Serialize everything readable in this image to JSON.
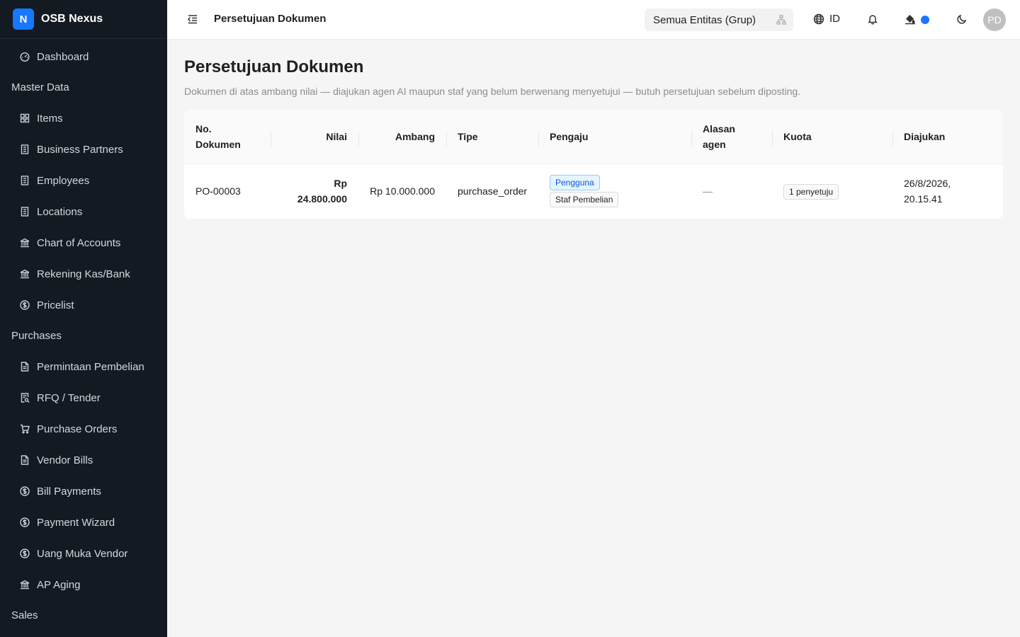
{
  "brand": {
    "logo_letter": "N",
    "name": "OSB Nexus"
  },
  "sidebar": {
    "items": [
      {
        "type": "item",
        "label": "Dashboard",
        "icon": "dashboard-icon"
      },
      {
        "type": "group",
        "label": "Master Data"
      },
      {
        "type": "item",
        "label": "Items",
        "icon": "grid-icon"
      },
      {
        "type": "item",
        "label": "Business Partners",
        "icon": "building-icon"
      },
      {
        "type": "item",
        "label": "Employees",
        "icon": "building-icon"
      },
      {
        "type": "item",
        "label": "Locations",
        "icon": "building-icon"
      },
      {
        "type": "item",
        "label": "Chart of Accounts",
        "icon": "bank-icon"
      },
      {
        "type": "item",
        "label": "Rekening Kas/Bank",
        "icon": "bank-icon"
      },
      {
        "type": "item",
        "label": "Pricelist",
        "icon": "dollar-icon"
      },
      {
        "type": "group",
        "label": "Purchases"
      },
      {
        "type": "item",
        "label": "Permintaan Pembelian",
        "icon": "document-icon"
      },
      {
        "type": "item",
        "label": "RFQ / Tender",
        "icon": "document-search-icon"
      },
      {
        "type": "item",
        "label": "Purchase Orders",
        "icon": "cart-icon"
      },
      {
        "type": "item",
        "label": "Vendor Bills",
        "icon": "document-icon"
      },
      {
        "type": "item",
        "label": "Bill Payments",
        "icon": "dollar-icon"
      },
      {
        "type": "item",
        "label": "Payment Wizard",
        "icon": "dollar-icon"
      },
      {
        "type": "item",
        "label": "Uang Muka Vendor",
        "icon": "dollar-icon"
      },
      {
        "type": "item",
        "label": "AP Aging",
        "icon": "bank-icon"
      },
      {
        "type": "group",
        "label": "Sales"
      }
    ]
  },
  "header": {
    "title": "Persetujuan Dokumen",
    "entity_select": "Semua Entitas (Grup)",
    "language": "ID",
    "avatar_initials": "PD",
    "accent_color": "#1677ff"
  },
  "main": {
    "title": "Persetujuan Dokumen",
    "description": "Dokumen di atas ambang nilai — diajukan agen AI maupun staf yang belum berwenang menyetujui — butuh persetujuan sebelum diposting.",
    "columns": [
      "No. Dokumen",
      "Nilai",
      "Ambang",
      "Tipe",
      "Pengaju",
      "Alasan agen",
      "Kuota",
      "Diajukan"
    ],
    "rows": [
      {
        "doc_no": "PO-00003",
        "nilai": "Rp 24.800.000",
        "ambang": "Rp 10.000.000",
        "tipe": "purchase_order",
        "pengaju_tags": [
          "Pengguna",
          "Staf Pembelian"
        ],
        "alasan": "—",
        "kuota": "1 penyetuju",
        "diajukan": "26/8/2026, 20.15.41"
      }
    ]
  }
}
